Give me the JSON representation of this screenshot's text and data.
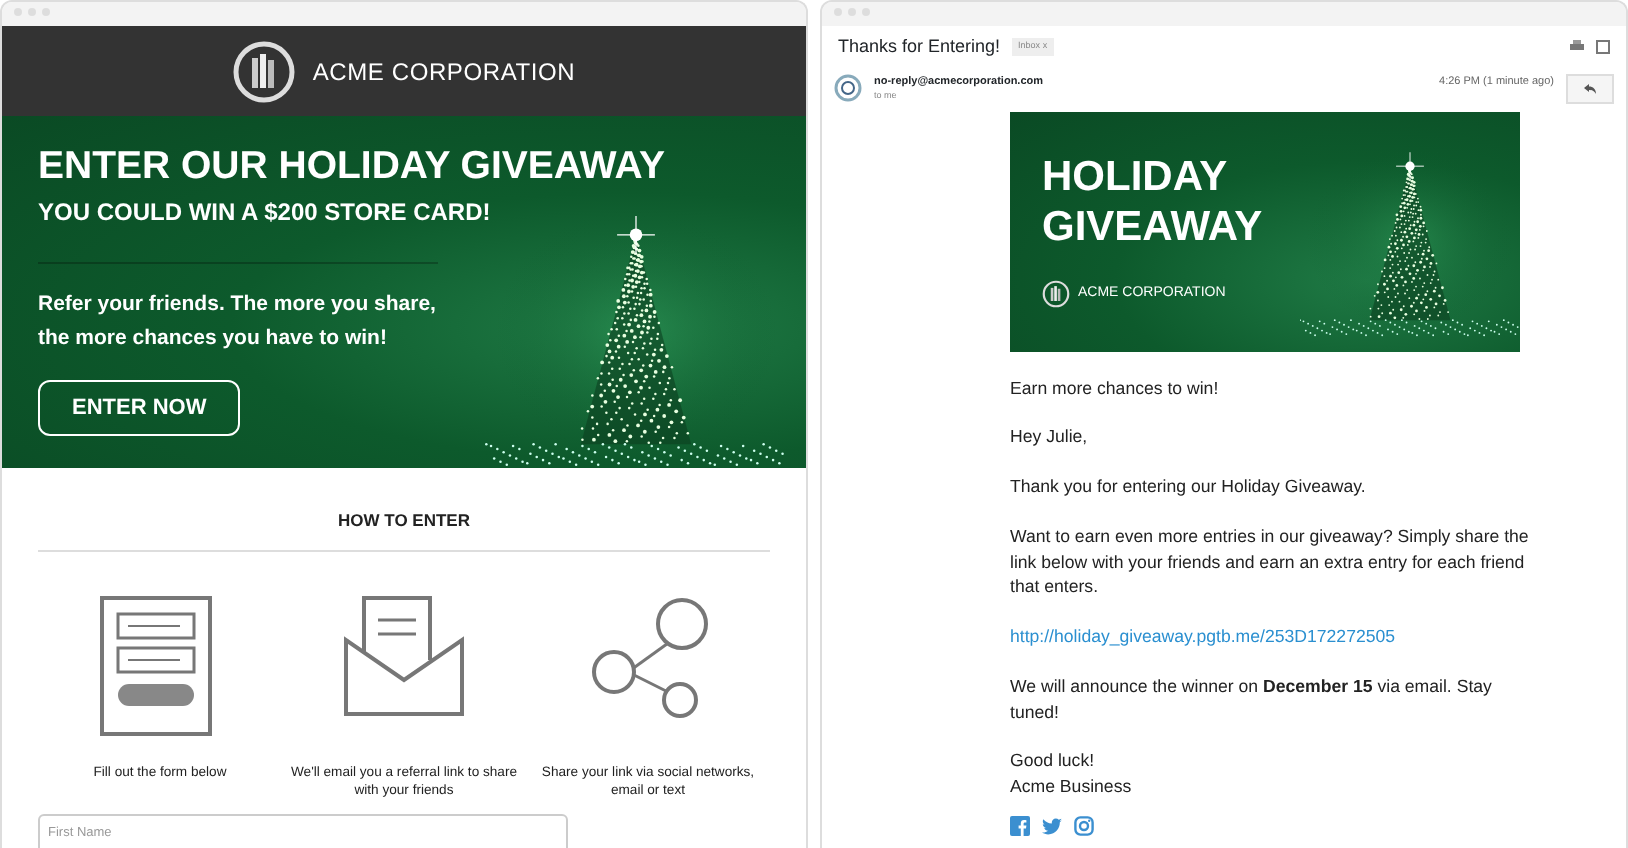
{
  "landing": {
    "logo_text": "ACME CORPORATION",
    "hero": {
      "title": "ENTER OUR HOLIDAY GIVEAWAY",
      "subtitle": "YOU COULD WIN A $200 STORE CARD!",
      "text": "Refer your friends. The more you share, the more chances you have to win!",
      "button": "ENTER NOW"
    },
    "how_to_enter": {
      "heading": "HOW TO ENTER",
      "steps": [
        {
          "kind": "form",
          "text": "Fill out the form below"
        },
        {
          "kind": "email",
          "text": "We'll email you a referral link to share with your friends"
        },
        {
          "kind": "share",
          "text": "Share your link via social networks, email or text"
        }
      ]
    },
    "form": {
      "first_name_placeholder": "First Name"
    }
  },
  "email": {
    "subject": "Thanks for Entering!",
    "label": "Inbox",
    "label_close": "x",
    "sender": "no-reply@acmecorporation.com",
    "to": "to me",
    "time": "4:26 PM (1 minute ago)",
    "banner": {
      "title_lines": [
        "HOLIDAY",
        "GIVEAWAY"
      ],
      "logo_text": "ACME CORPORATION"
    },
    "body": [
      {
        "kind": "text",
        "lines": [
          "Earn more chances to win!"
        ]
      },
      {
        "kind": "text",
        "lines": [
          "Hey Julie,"
        ]
      },
      {
        "kind": "text",
        "lines": [
          "Thank you for entering our Holiday Giveaway."
        ]
      },
      {
        "kind": "text",
        "lines": [
          "Want to earn even more entries in our giveaway? Simply share the link below with your friends and earn an extra entry for each friend that enters."
        ]
      },
      {
        "kind": "link",
        "lines": [
          "http://holiday_giveaway.pgtb.me/253D172272505"
        ]
      },
      {
        "kind": "text",
        "lines": [
          "We will announce the winner on **December 15** via email. Stay tuned!"
        ]
      },
      {
        "kind": "text",
        "lines": [
          "Good luck!",
          "Acme Business"
        ]
      }
    ],
    "social": [
      {
        "kind": "facebook"
      },
      {
        "kind": "twitter"
      },
      {
        "kind": "instagram"
      }
    ]
  }
}
